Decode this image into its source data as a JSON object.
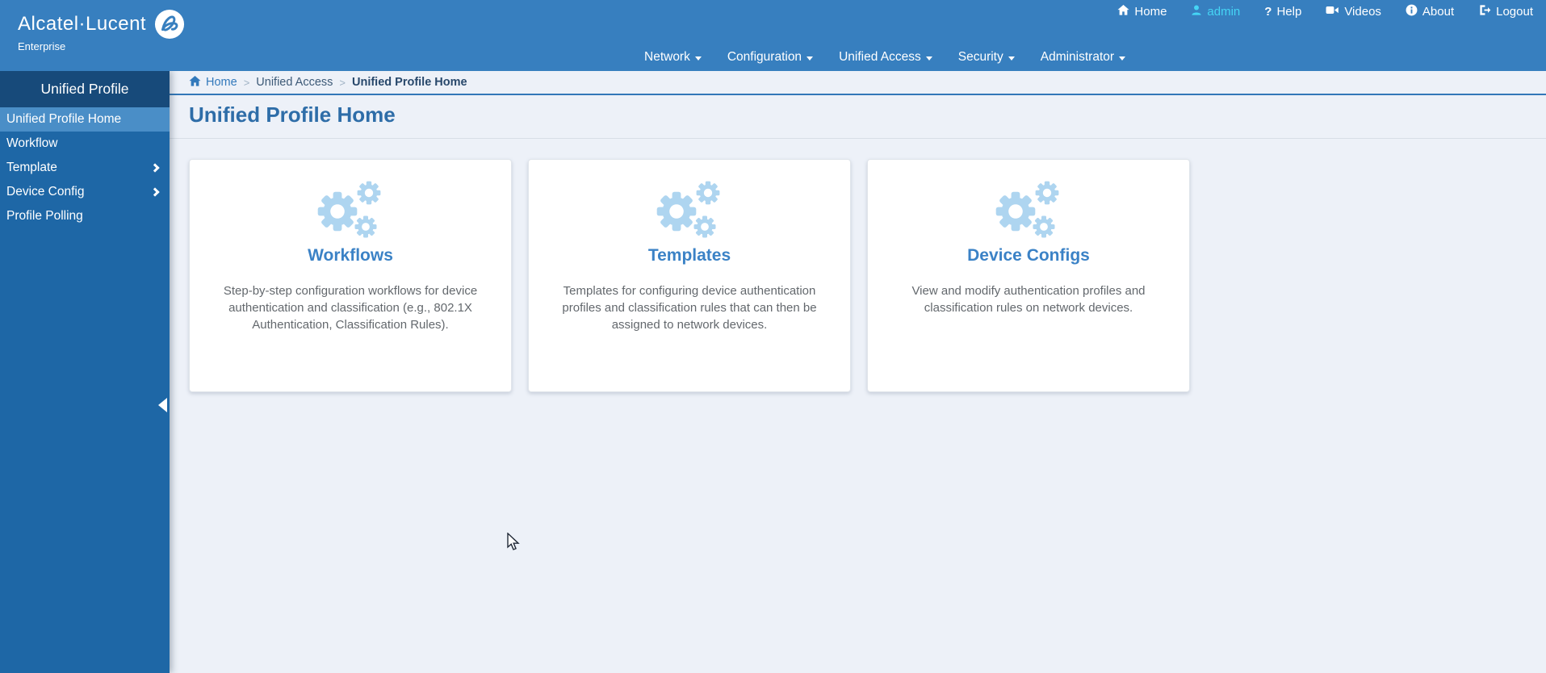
{
  "brand": {
    "name": "Alcatel·Lucent",
    "subtitle": "Enterprise"
  },
  "topbar": {
    "utility": [
      {
        "label": "Home"
      },
      {
        "label": "admin"
      },
      {
        "label": "Help"
      },
      {
        "label": "Videos"
      },
      {
        "label": "About"
      },
      {
        "label": "Logout"
      }
    ],
    "menus": [
      {
        "label": "Network"
      },
      {
        "label": "Configuration"
      },
      {
        "label": "Unified Access"
      },
      {
        "label": "Security"
      },
      {
        "label": "Administrator"
      }
    ]
  },
  "sidebar": {
    "title": "Unified Profile",
    "items": [
      {
        "label": "Unified Profile Home",
        "selected": true
      },
      {
        "label": "Workflow"
      },
      {
        "label": "Template",
        "has_submenu": true
      },
      {
        "label": "Device Config",
        "has_submenu": true
      },
      {
        "label": "Profile Polling"
      }
    ]
  },
  "breadcrumb": {
    "items": [
      {
        "label": "Home"
      },
      {
        "label": "Unified Access"
      },
      {
        "label": "Unified Profile Home"
      }
    ]
  },
  "page": {
    "title": "Unified Profile Home"
  },
  "cards": [
    {
      "title": "Workflows",
      "description": "Step-by-step configuration workflows for device authentication and classification (e.g., 802.1X Authentication, Classification Rules)."
    },
    {
      "title": "Templates",
      "description": "Templates for configuring device authentication profiles and classification rules that can then be assigned to network devices."
    },
    {
      "title": "Device Configs",
      "description": "View and modify authentication profiles and classification rules on network devices."
    }
  ],
  "colors": {
    "topbar": "#377fbf",
    "sidebar": "#1e67a6",
    "sidebar_header": "#174a7a",
    "sidebar_selected": "#4a8ec7",
    "accent_link": "#3279bb",
    "card_title": "#3b82c6",
    "gear": "#aed5f0",
    "admin_highlight": "#45d5f5",
    "content_bg": "#edf1f8"
  }
}
